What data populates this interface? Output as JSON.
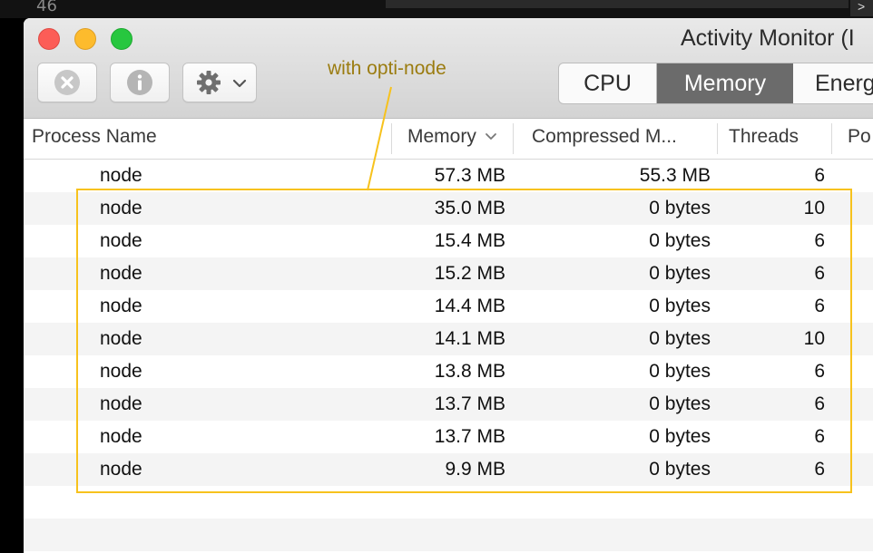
{
  "background": {
    "terminal_number": "46",
    "corner_glyph": ">"
  },
  "window": {
    "title": "Activity Monitor (I",
    "toolbar": {
      "stop_icon": "x-circle-icon",
      "info_icon": "info-icon",
      "gear_icon": "gear-icon"
    },
    "tabs": [
      {
        "label": "CPU",
        "selected": false
      },
      {
        "label": "Memory",
        "selected": true
      },
      {
        "label": "Energ",
        "selected": false
      }
    ]
  },
  "annotation": {
    "label": "with opti-node",
    "color": "#f7c21d"
  },
  "table": {
    "headers": {
      "name": "Process Name",
      "memory": "Memory",
      "compressed": "Compressed M...",
      "threads": "Threads",
      "ports": "Po"
    },
    "rows": [
      {
        "name": "node",
        "memory": "57.3 MB",
        "compressed": "55.3 MB",
        "threads": "6"
      },
      {
        "name": "node",
        "memory": "35.0 MB",
        "compressed": "0 bytes",
        "threads": "10"
      },
      {
        "name": "node",
        "memory": "15.4 MB",
        "compressed": "0 bytes",
        "threads": "6"
      },
      {
        "name": "node",
        "memory": "15.2 MB",
        "compressed": "0 bytes",
        "threads": "6"
      },
      {
        "name": "node",
        "memory": "14.4 MB",
        "compressed": "0 bytes",
        "threads": "6"
      },
      {
        "name": "node",
        "memory": "14.1 MB",
        "compressed": "0 bytes",
        "threads": "10"
      },
      {
        "name": "node",
        "memory": "13.8 MB",
        "compressed": "0 bytes",
        "threads": "6"
      },
      {
        "name": "node",
        "memory": "13.7 MB",
        "compressed": "0 bytes",
        "threads": "6"
      },
      {
        "name": "node",
        "memory": "13.7 MB",
        "compressed": "0 bytes",
        "threads": "6"
      },
      {
        "name": "node",
        "memory": "9.9 MB",
        "compressed": "0 bytes",
        "threads": "6"
      }
    ]
  }
}
